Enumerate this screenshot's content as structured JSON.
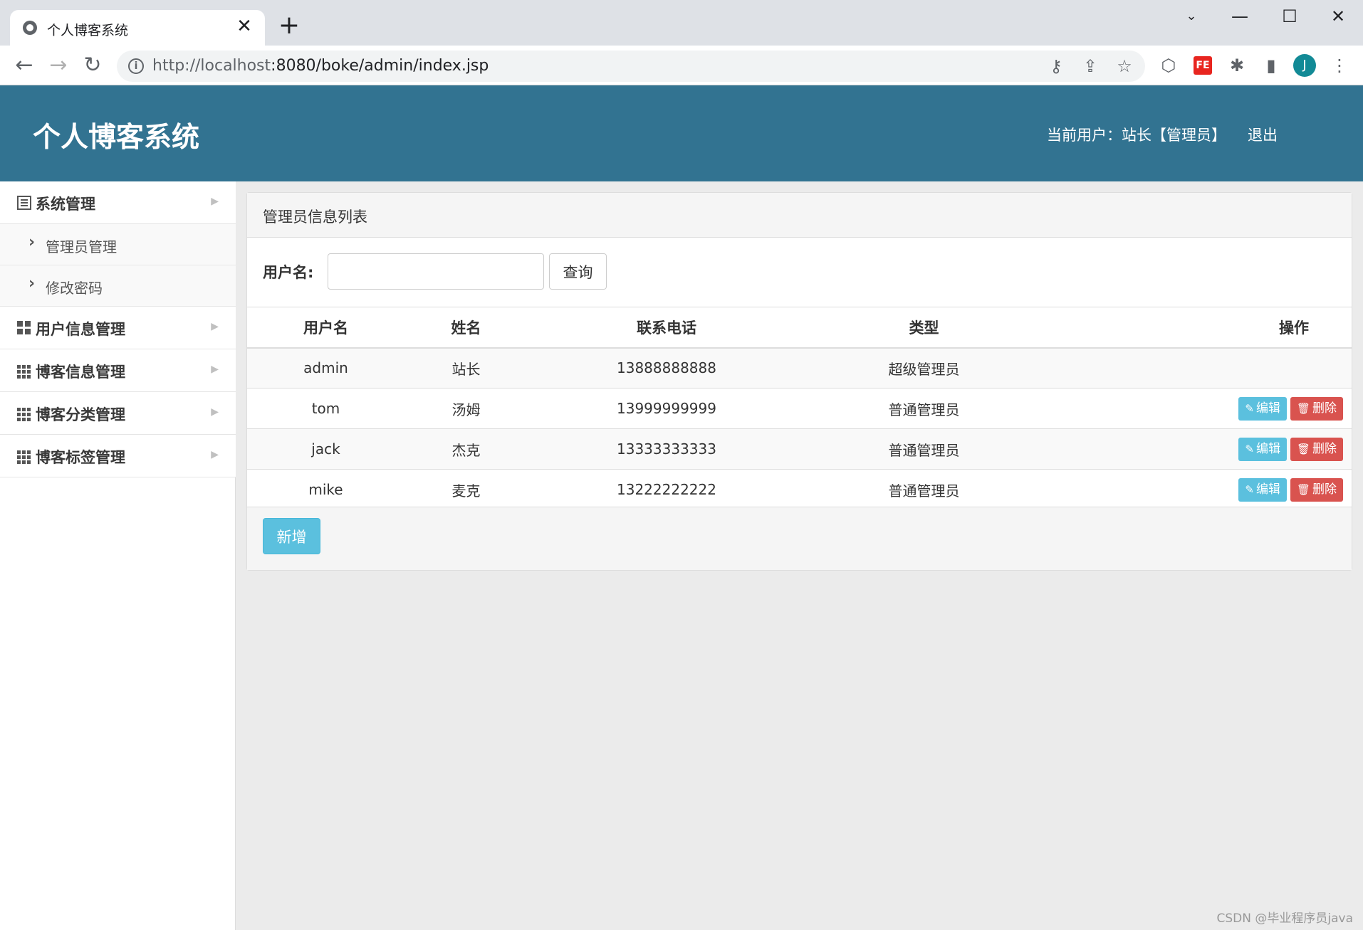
{
  "browser": {
    "tab_title": "个人博客系统",
    "tab_close": "✕",
    "new_tab": "+",
    "url_host": "http://localhost",
    "url_rest": ":8080/boke/admin/index.jsp"
  },
  "header": {
    "app_title": "个人博客系统",
    "current_user": "当前用户：站长【管理员】",
    "logout": "退出"
  },
  "sidebar": {
    "items": [
      {
        "label": "系统管理",
        "icon": "list-icon"
      },
      {
        "label": "用户信息管理",
        "icon": "grid-icon"
      },
      {
        "label": "博客信息管理",
        "icon": "grid9-icon"
      },
      {
        "label": "博客分类管理",
        "icon": "grid9-icon"
      },
      {
        "label": "博客标签管理",
        "icon": "grid9-icon"
      }
    ],
    "sub_items": [
      {
        "label": "管理员管理"
      },
      {
        "label": "修改密码"
      }
    ]
  },
  "panel": {
    "title": "管理员信息列表",
    "search_label": "用户名:",
    "search_value": "",
    "search_button": "查询",
    "add_button": "新增"
  },
  "table": {
    "headers": [
      "用户名",
      "姓名",
      "联系电话",
      "类型",
      "操作"
    ],
    "rows": [
      {
        "username": "admin",
        "name": "站长",
        "phone": "13888888888",
        "type": "超级管理员",
        "actions": false
      },
      {
        "username": "tom",
        "name": "汤姆",
        "phone": "13999999999",
        "type": "普通管理员",
        "actions": true
      },
      {
        "username": "jack",
        "name": "杰克",
        "phone": "13333333333",
        "type": "普通管理员",
        "actions": true
      },
      {
        "username": "mike",
        "name": "麦克",
        "phone": "13222222222",
        "type": "普通管理员",
        "actions": true
      }
    ],
    "edit_label": "编辑",
    "delete_label": "删除"
  },
  "watermark": "CSDN @毕业程序员java",
  "colors": {
    "header_bg": "#327391",
    "info_button": "#5bc0de",
    "danger_button": "#d9534f"
  }
}
